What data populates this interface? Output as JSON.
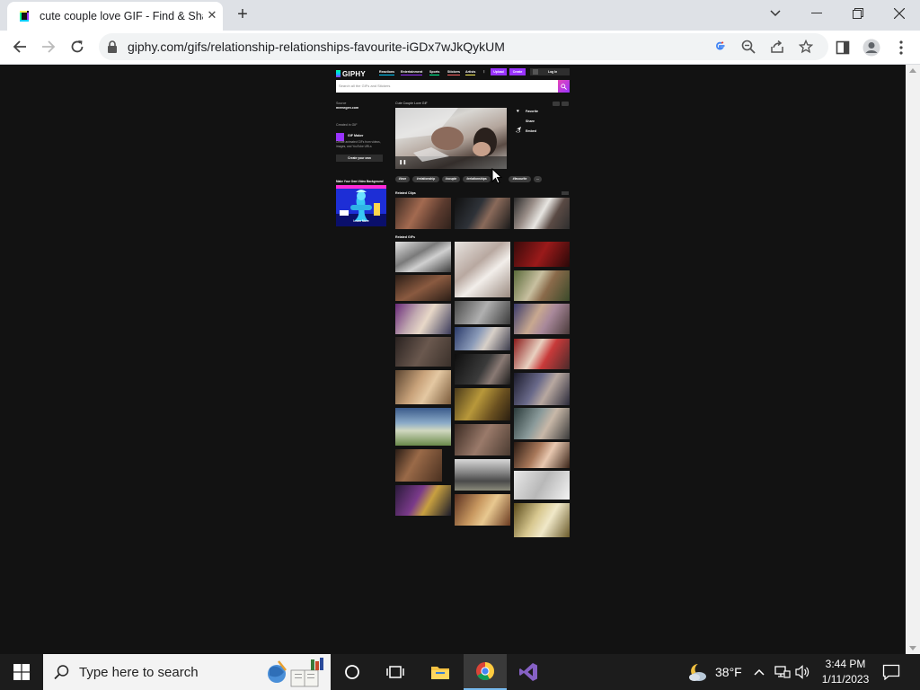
{
  "browser": {
    "tab_title": "cute couple love GIF - Find & Share on GIPHY",
    "close_tab": "✕",
    "new_tab": "+",
    "url": "giphy.com/gifs/relationship-relationships-favourite-iGDx7wJkQykUM"
  },
  "giphy": {
    "logo": "GIPHY",
    "nav": [
      "Reactions",
      "Entertainment",
      "Sports",
      "Stickers",
      "Artists",
      "⋮"
    ],
    "upload": "Upload",
    "create": "Create",
    "login": "Log In",
    "search_placeholder": "Search all the GIFs and Stickers",
    "sidebar": {
      "source_label": "Source",
      "source_value": "memegen.com",
      "contact_label": "Created in GIF",
      "maker_title": "GIF Maker",
      "maker_desc": "Create animated GIFs from videos, images, and YouTube URLs",
      "create_btn": "Create your own",
      "ad_title": "Make Your Own Video Background",
      "ad_cta": "Learn More"
    },
    "gif_title": "Cute Couple Love GIF",
    "actions": [
      "Favorite",
      "Share",
      "Embed"
    ],
    "tags": [
      "#love",
      "#relationship",
      "#couple",
      "#relationships",
      "#favourite",
      "..."
    ],
    "related_clips_label": "Related Clips",
    "related_gifs_label": "Related GIFs"
  },
  "taskbar": {
    "search_placeholder": "Type here to search",
    "temperature": "38°F",
    "time": "3:44 PM",
    "date": "1/11/2023"
  }
}
